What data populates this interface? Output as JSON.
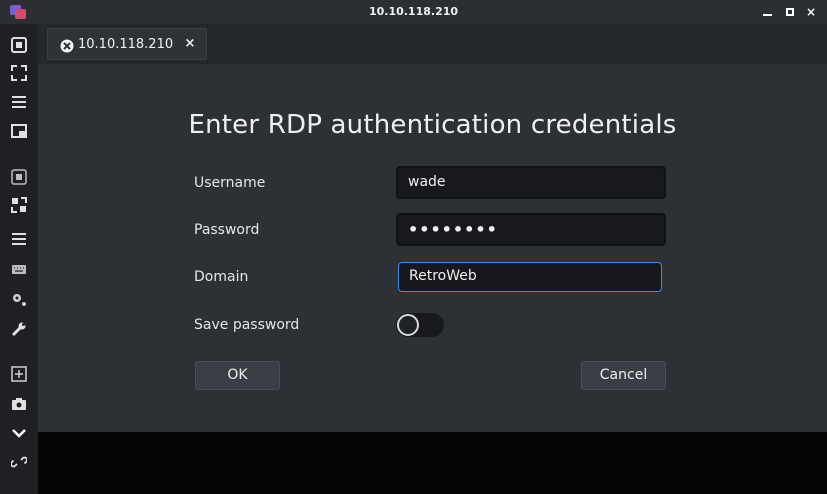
{
  "window": {
    "title": "10.10.118.210",
    "controls": {
      "minimize": "minimize",
      "maximize": "maximize",
      "close": "×"
    }
  },
  "sidebar": {
    "icons": [
      "expand-screen-icon",
      "fullscreen-icon",
      "menu-icon",
      "window-icon",
      "grab-keyboard-icon",
      "scale-icon",
      "menu-icon",
      "keyboard-icon",
      "preferences-icon",
      "tools-icon",
      "new-connection-icon",
      "screenshot-icon",
      "chevron-down-icon",
      "disconnect-icon"
    ]
  },
  "tab": {
    "label": "10.10.118.210",
    "close": "×"
  },
  "dialog": {
    "title": "Enter RDP authentication credentials",
    "username_label": "Username",
    "username_value": "wade",
    "password_label": "Password",
    "password_mask": "••••••••",
    "domain_label": "Domain",
    "domain_value": "RetroWeb",
    "save_password_label": "Save password",
    "save_password_enabled": false,
    "ok_label": "OK",
    "cancel_label": "Cancel"
  },
  "colors": {
    "focus_border": "#3b8cf0",
    "background": "#2d3035",
    "titlebar": "#2b2e33"
  }
}
